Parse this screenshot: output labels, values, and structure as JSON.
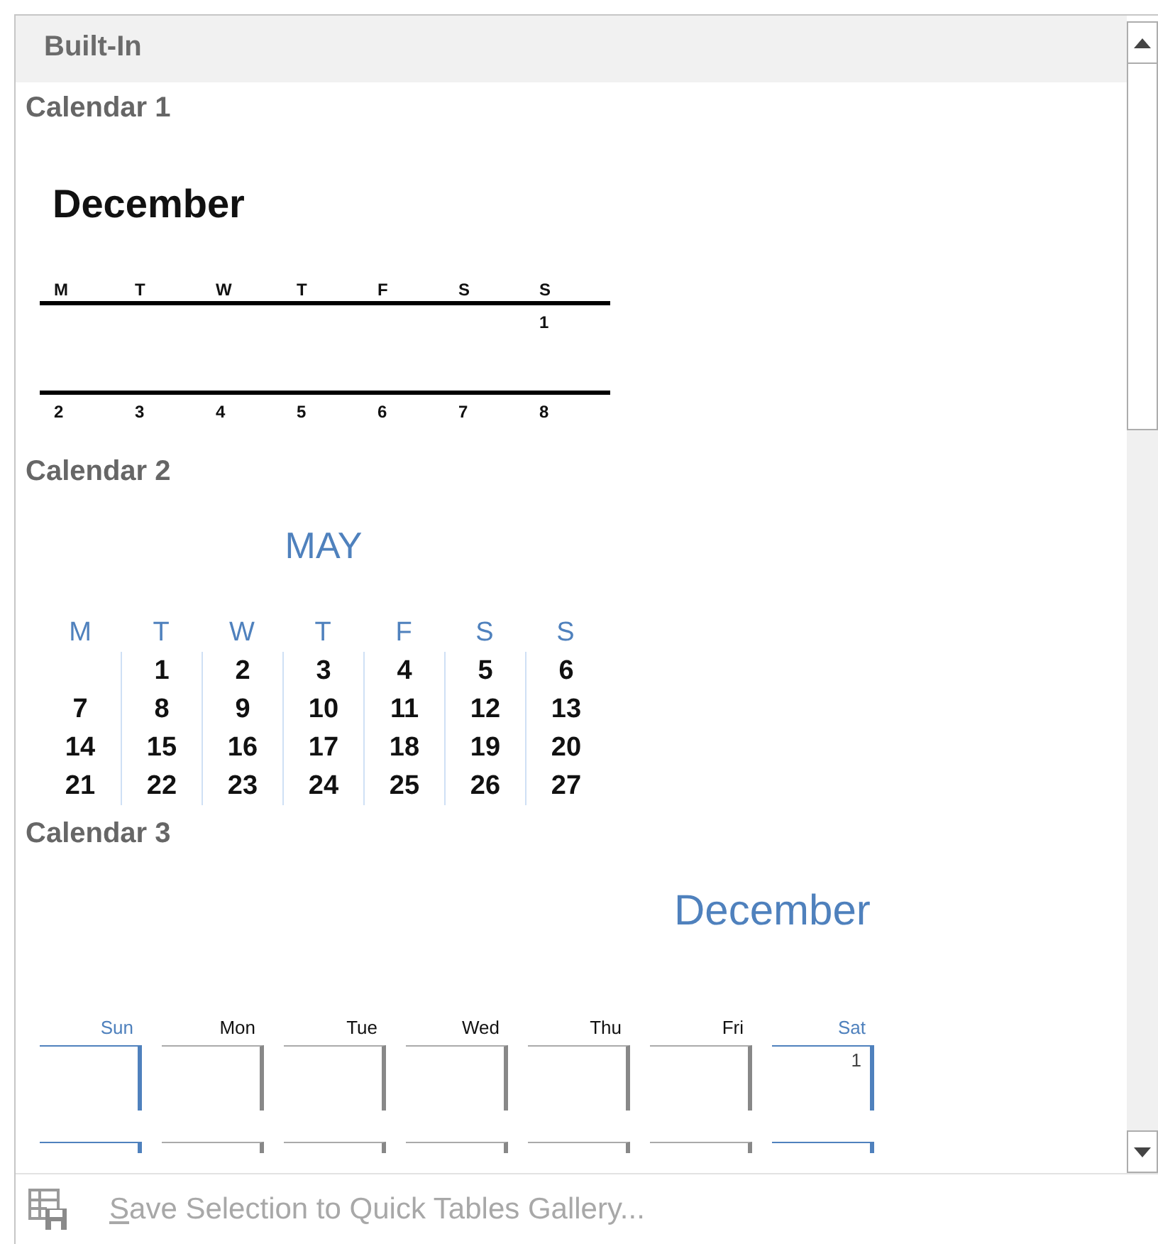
{
  "header": "Built-In",
  "items": [
    {
      "kind": "calendar1",
      "title": "Calendar 1",
      "month": "December",
      "weekdays": [
        "M",
        "T",
        "W",
        "T",
        "F",
        "S",
        "S"
      ],
      "weeks": [
        [
          {
            "kind": "blank"
          },
          {
            "kind": "blank"
          },
          {
            "kind": "blank"
          },
          {
            "kind": "blank"
          },
          {
            "kind": "blank"
          },
          {
            "kind": "blank"
          },
          {
            "kind": "day",
            "day": "1"
          }
        ],
        [
          {
            "kind": "day",
            "day": "2"
          },
          {
            "kind": "day",
            "day": "3"
          },
          {
            "kind": "day",
            "day": "4"
          },
          {
            "kind": "day",
            "day": "5"
          },
          {
            "kind": "day",
            "day": "6"
          },
          {
            "kind": "day",
            "day": "7"
          },
          {
            "kind": "day",
            "day": "8"
          }
        ]
      ]
    },
    {
      "kind": "calendar2",
      "title": "Calendar 2",
      "month": "MAY",
      "weekdays": [
        "M",
        "T",
        "W",
        "T",
        "F",
        "S",
        "S"
      ],
      "weeks": [
        [
          {
            "kind": "blank"
          },
          {
            "kind": "day",
            "day": "1"
          },
          {
            "kind": "day",
            "day": "2"
          },
          {
            "kind": "day",
            "day": "3"
          },
          {
            "kind": "day",
            "day": "4"
          },
          {
            "kind": "day",
            "day": "5"
          },
          {
            "kind": "day",
            "day": "6"
          }
        ],
        [
          {
            "kind": "day",
            "day": "7"
          },
          {
            "kind": "day",
            "day": "8"
          },
          {
            "kind": "day",
            "day": "9"
          },
          {
            "kind": "day",
            "day": "10"
          },
          {
            "kind": "day",
            "day": "11"
          },
          {
            "kind": "day",
            "day": "12"
          },
          {
            "kind": "day",
            "day": "13"
          }
        ],
        [
          {
            "kind": "day",
            "day": "14"
          },
          {
            "kind": "day",
            "day": "15"
          },
          {
            "kind": "day",
            "day": "16"
          },
          {
            "kind": "day",
            "day": "17"
          },
          {
            "kind": "day",
            "day": "18"
          },
          {
            "kind": "day",
            "day": "19"
          },
          {
            "kind": "day",
            "day": "20"
          }
        ],
        [
          {
            "kind": "day",
            "day": "21"
          },
          {
            "kind": "day",
            "day": "22"
          },
          {
            "kind": "day",
            "day": "23"
          },
          {
            "kind": "day",
            "day": "24"
          },
          {
            "kind": "day",
            "day": "25"
          },
          {
            "kind": "day",
            "day": "26"
          },
          {
            "kind": "day",
            "day": "27"
          }
        ]
      ]
    },
    {
      "kind": "calendar3",
      "title": "Calendar 3",
      "month": "December",
      "weekdays": [
        {
          "label": "Sun",
          "weekend": true
        },
        {
          "label": "Mon",
          "weekend": false
        },
        {
          "label": "Tue",
          "weekend": false
        },
        {
          "label": "Wed",
          "weekend": false
        },
        {
          "label": "Thu",
          "weekend": false
        },
        {
          "label": "Fri",
          "weekend": false
        },
        {
          "label": "Sat",
          "weekend": true
        }
      ],
      "weeks": [
        [
          {
            "kind": "blank"
          },
          {
            "kind": "blank"
          },
          {
            "kind": "blank"
          },
          {
            "kind": "blank"
          },
          {
            "kind": "blank"
          },
          {
            "kind": "blank"
          },
          {
            "kind": "day",
            "day": "1"
          }
        ],
        [
          {
            "kind": "blank"
          },
          {
            "kind": "blank"
          },
          {
            "kind": "blank"
          },
          {
            "kind": "blank"
          },
          {
            "kind": "blank"
          },
          {
            "kind": "blank"
          },
          {
            "kind": "blank"
          }
        ]
      ]
    }
  ],
  "footer": {
    "mnemonic": "S",
    "label_rest": "ave Selection to Quick Tables Gallery...",
    "disabled": true
  }
}
